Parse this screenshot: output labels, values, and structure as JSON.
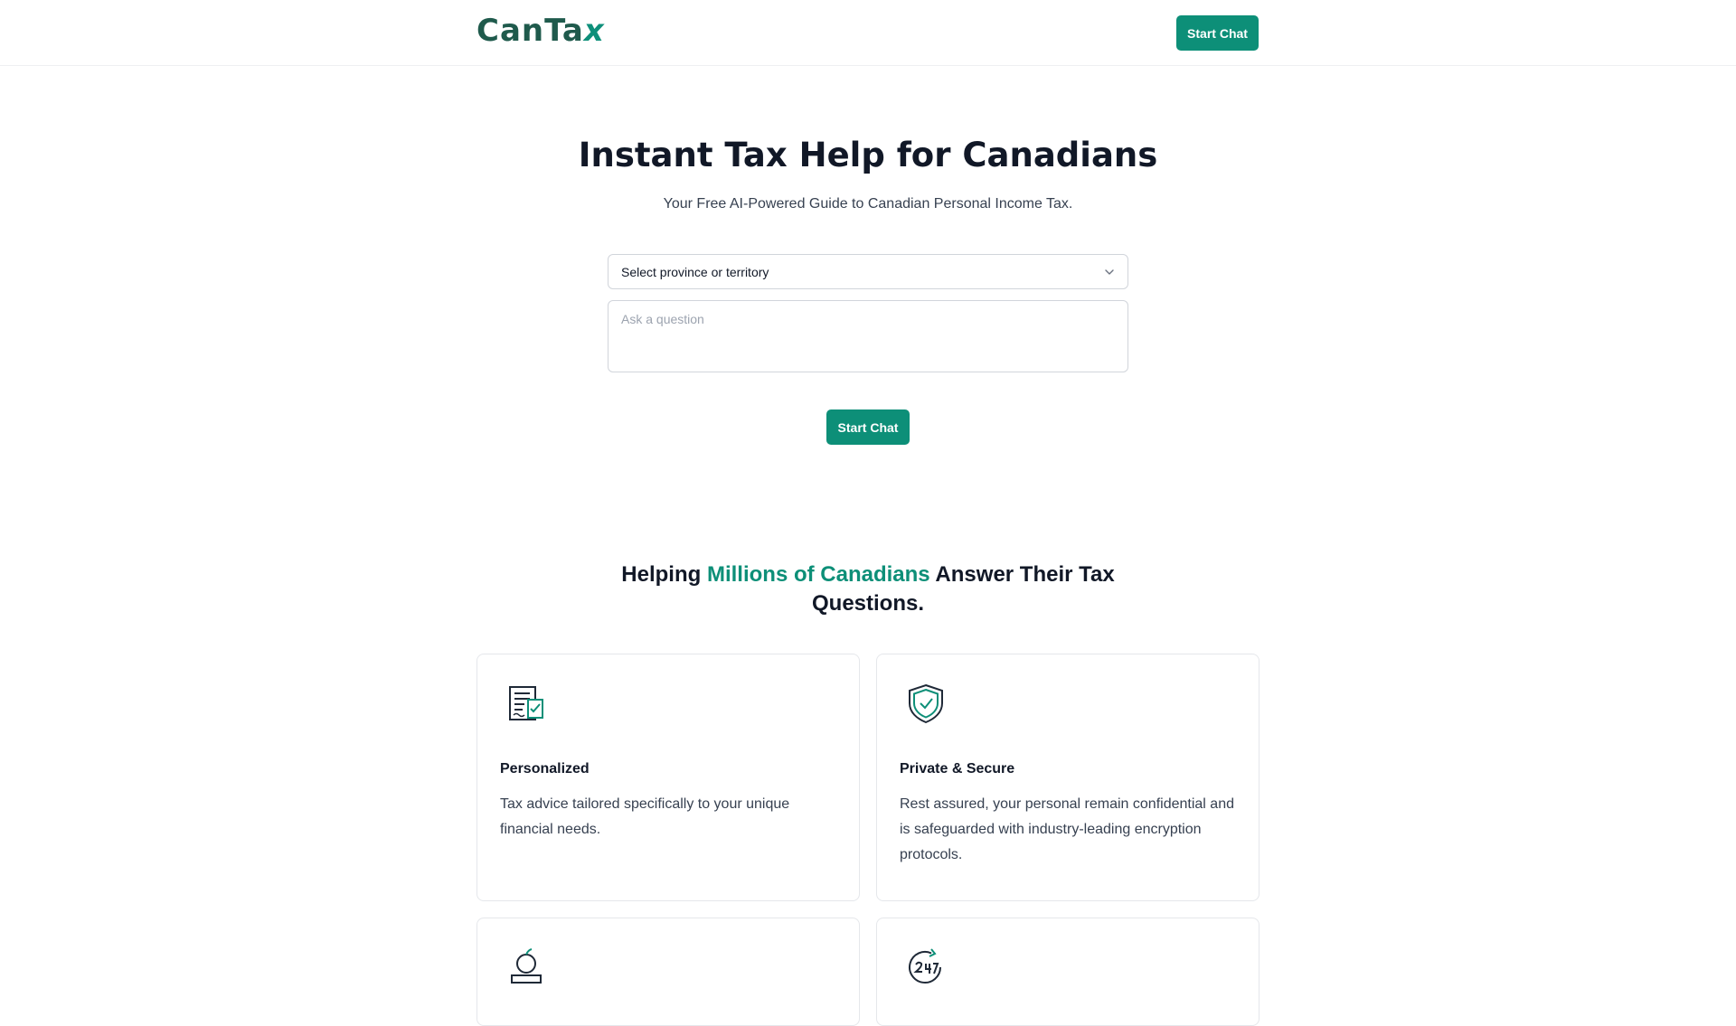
{
  "header": {
    "logo_text": "CanTa",
    "logo_x": "x",
    "cta_label": "Start Chat"
  },
  "hero": {
    "title": "Instant Tax Help for Canadians",
    "subtitle": "Your Free AI-Powered Guide to Canadian Personal Income Tax.",
    "province_select": "Select province or territory",
    "question_placeholder": "Ask a question",
    "start_label": "Start Chat"
  },
  "features_section": {
    "title_prefix": "Helping ",
    "title_accent": "Millions of Canadians",
    "title_suffix": " Answer Their Tax Questions."
  },
  "cards": [
    {
      "icon": "document-checklist-icon",
      "title": "Personalized",
      "text": "Tax advice tailored specifically to your unique financial needs."
    },
    {
      "icon": "shield-check-icon",
      "title": "Private & Secure",
      "text": "Rest assured, your personal remain confidential and is safeguarded with industry-leading encryption protocols."
    },
    {
      "icon": "apple-books-icon",
      "title": "",
      "text": ""
    },
    {
      "icon": "clock-24-7-icon",
      "title": "",
      "text": ""
    }
  ],
  "colors": {
    "accent": "#0d8f78",
    "logo": "#1f5a4c",
    "text": "#111827"
  }
}
